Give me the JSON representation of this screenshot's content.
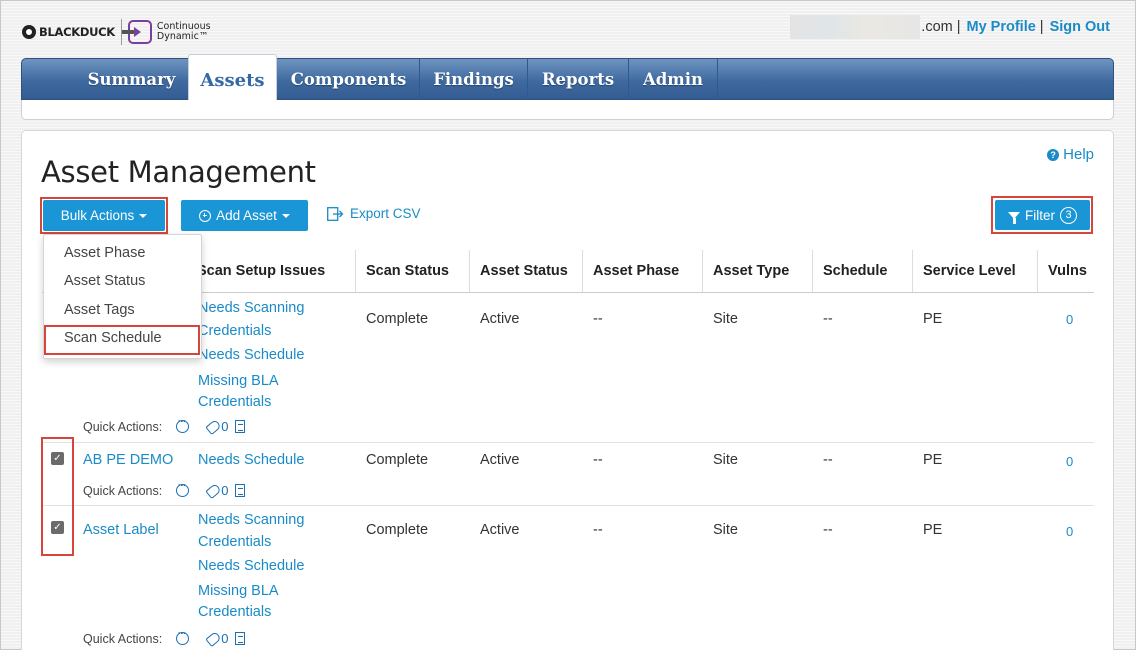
{
  "header": {
    "logo_blackduck": "BLACKDUCK",
    "logo_cd_line1": "Continuous",
    "logo_cd_line2": "Dynamic™",
    "email_domain": ".com",
    "separator": "|",
    "my_profile": "My Profile",
    "sign_out": "Sign Out"
  },
  "nav": {
    "tabs": [
      {
        "label": "Summary"
      },
      {
        "label": "Assets"
      },
      {
        "label": "Components"
      },
      {
        "label": "Findings"
      },
      {
        "label": "Reports"
      },
      {
        "label": "Admin"
      }
    ],
    "active_tab": "Assets"
  },
  "page": {
    "title": "Asset Management",
    "help": "Help",
    "help_icon": "?"
  },
  "toolbar": {
    "bulk_actions": "Bulk Actions",
    "add_asset": "Add Asset",
    "export_csv": "Export CSV",
    "filter": "Filter",
    "filter_count": "3"
  },
  "bulk_menu": {
    "items": [
      "Asset Phase",
      "Asset Status",
      "Asset Tags",
      "Scan Schedule"
    ],
    "highlighted": "Scan Schedule"
  },
  "table": {
    "columns": [
      "Scan Setup Issues",
      "Scan Status",
      "Asset Status",
      "Asset Phase",
      "Asset Type",
      "Schedule",
      "Service Level",
      "Vulns"
    ],
    "quick_actions_label": "Quick Actions:",
    "rows": [
      {
        "name": "",
        "checked": false,
        "issues": [
          "Needs Scanning",
          "Credentials",
          "Needs Schedule",
          "Missing BLA",
          "Credentials"
        ],
        "scan_status": "Complete",
        "asset_status": "Active",
        "asset_phase": "--",
        "asset_type": "Site",
        "schedule": "--",
        "service_level": "PE",
        "vulns": "0",
        "tag_count": "0"
      },
      {
        "name": "AB PE DEMO",
        "checked": true,
        "issues": [
          "Needs Schedule"
        ],
        "scan_status": "Complete",
        "asset_status": "Active",
        "asset_phase": "--",
        "asset_type": "Site",
        "schedule": "--",
        "service_level": "PE",
        "vulns": "0",
        "tag_count": "0"
      },
      {
        "name": "Asset Label",
        "checked": true,
        "issues": [
          "Needs Scanning",
          "Credentials",
          "Needs Schedule",
          "Missing BLA",
          "Credentials"
        ],
        "scan_status": "Complete",
        "asset_status": "Active",
        "asset_phase": "--",
        "asset_type": "Site",
        "schedule": "--",
        "service_level": "PE",
        "vulns": "0",
        "tag_count": "0"
      }
    ]
  },
  "colors": {
    "accent_blue": "#1a95d5",
    "link_blue": "#1a8bc7",
    "nav_blue": "#3f6aa0",
    "highlight_red": "#d6463c"
  }
}
